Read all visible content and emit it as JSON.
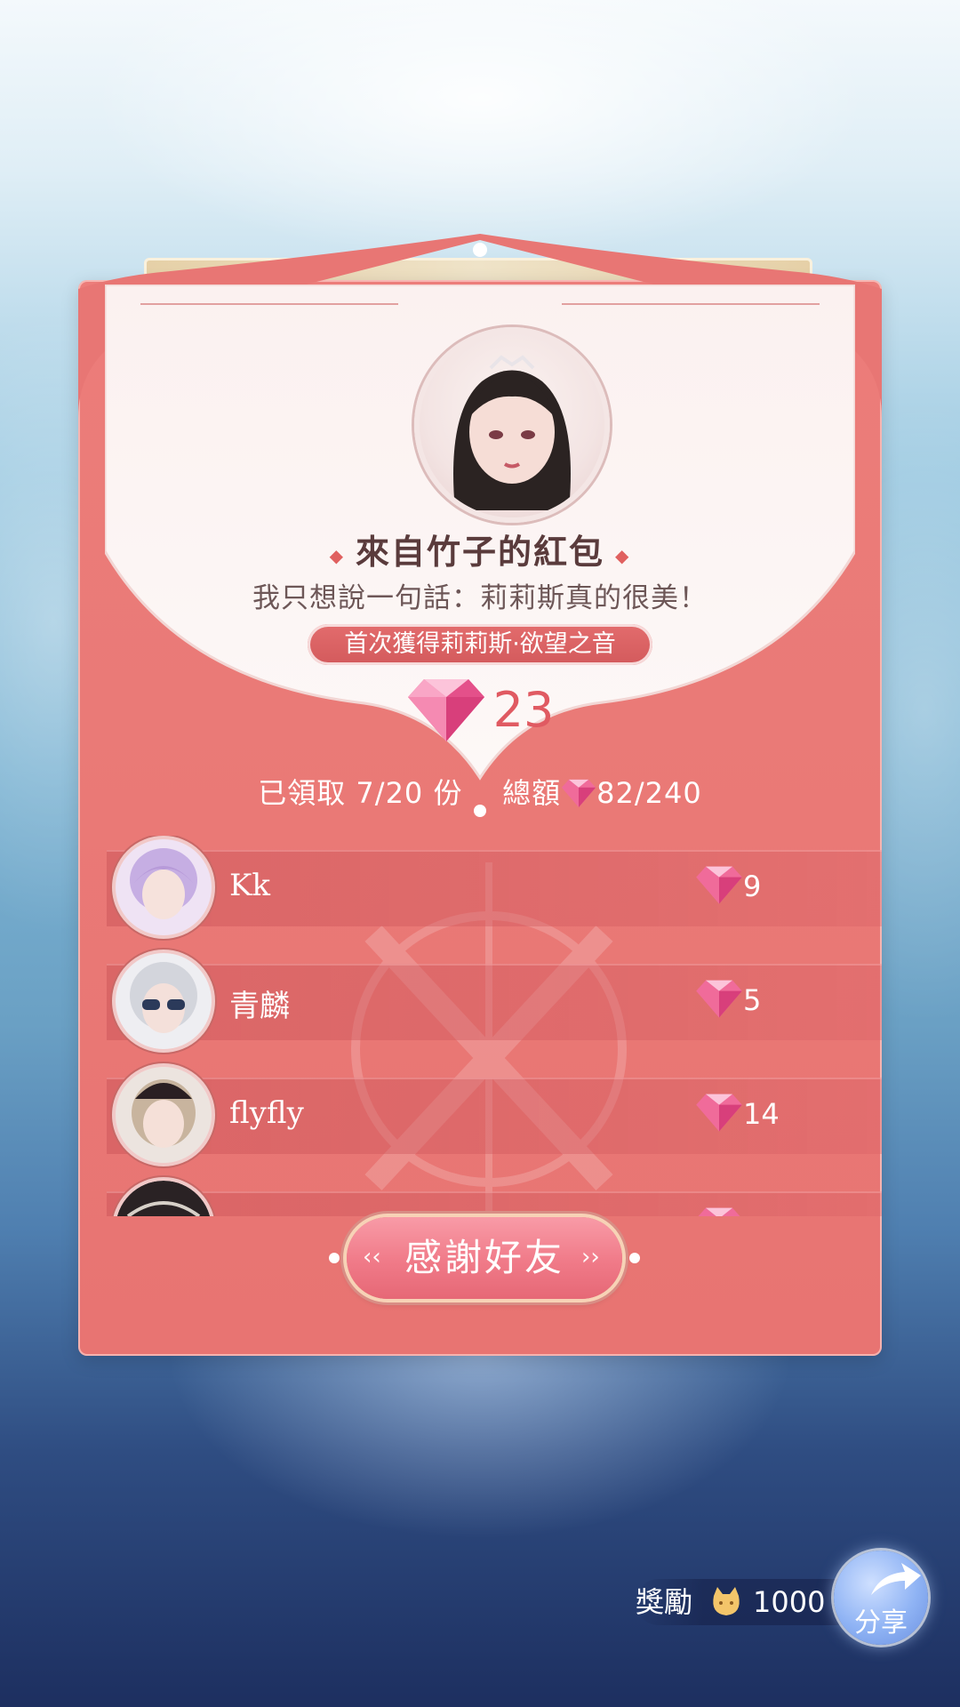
{
  "envelope": {
    "title": "來自竹子的紅包",
    "message": "我只想說一句話：莉莉斯真的很美！",
    "badge": "首次獲得莉莉斯·欲望之音",
    "amount": "23"
  },
  "summary": {
    "claimed_label": "已領取",
    "claimed_value": "7/20",
    "claimed_unit": "份",
    "total_label": "總額",
    "total_value": "82/240"
  },
  "recipients": [
    {
      "name": "Kk",
      "value": "9"
    },
    {
      "name": "青麟",
      "value": "5"
    },
    {
      "name": "flyfly",
      "value": "14"
    },
    {
      "name": "",
      "value": ""
    }
  ],
  "thanks_button": {
    "label": "感謝好友"
  },
  "reward": {
    "label": "獎勵",
    "value": "1000",
    "icon": "cat-coin-icon"
  },
  "share_button": {
    "label": "分享",
    "icon": "share-arrow-icon"
  },
  "colors": {
    "envelope": "#ea7a77",
    "accent": "#e05a62",
    "gem": "#f06b9a"
  }
}
